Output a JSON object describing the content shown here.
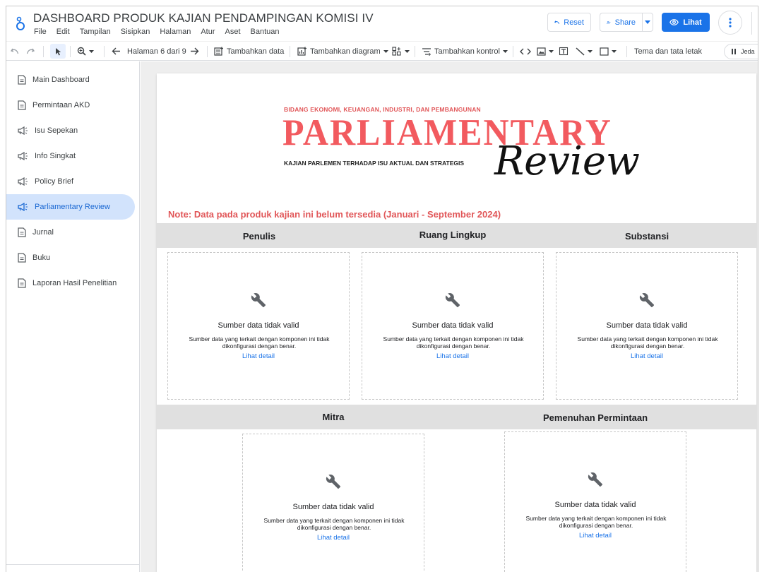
{
  "header": {
    "title": "DASHBOARD PRODUK KAJIAN PENDAMPINGAN KOMISI IV",
    "menu": [
      "File",
      "Edit",
      "Tampilan",
      "Sisipkan",
      "Halaman",
      "Atur",
      "Aset",
      "Bantuan"
    ],
    "reset_label": "Reset",
    "share_label": "Share",
    "view_label": "Lihat"
  },
  "toolbar": {
    "page_label": "Halaman 6 dari 9",
    "add_data": "Tambahkan data",
    "add_chart": "Tambahkan diagram",
    "add_control": "Tambahkan kontrol",
    "theme": "Tema dan tata letak",
    "pause": "Jeda"
  },
  "sidebar": {
    "items": [
      {
        "label": "Main Dashboard",
        "icon": "doc-icon"
      },
      {
        "label": "Permintaan AKD",
        "icon": "doc-icon"
      },
      {
        "label": "Isu Sepekan",
        "icon": "megaphone-icon"
      },
      {
        "label": "Info Singkat",
        "icon": "megaphone-icon"
      },
      {
        "label": "Policy Brief",
        "icon": "megaphone-icon"
      },
      {
        "label": "Parliamentary Review",
        "icon": "megaphone-icon",
        "active": true
      },
      {
        "label": "Jurnal",
        "icon": "doc-icon"
      },
      {
        "label": "Buku",
        "icon": "doc-icon"
      },
      {
        "label": "Laporan Hasil Penelitian",
        "icon": "doc-icon"
      }
    ]
  },
  "banner": {
    "top": "BIDANG EKONOMI, KEUANGAN, INDUSTRI, DAN PEMBANGUNAN",
    "big": "PARLIAMENTARY",
    "sub": "KAJIAN PARLEMEN TERHADAP ISU AKTUAL DAN STRATEGIS",
    "script": "Review"
  },
  "note": "Note: Data pada produk kajian ini belum tersedia (Januari - September 2024)",
  "sections": {
    "row1": [
      "Penulis",
      "Ruang Lingkup",
      "Substansi"
    ],
    "row2": [
      "Mitra",
      "Pemenuhan Permintaan"
    ]
  },
  "card": {
    "title": "Sumber data tidak valid",
    "desc": "Sumber data yang terkait dengan komponen ini tidak dikonfigurasi dengan benar.",
    "link": "Lihat detail"
  },
  "colors": {
    "accent": "#1a73e8",
    "banner_red": "#f25a5f",
    "note_red": "#e15759",
    "active_nav": "#d2e3fc"
  }
}
